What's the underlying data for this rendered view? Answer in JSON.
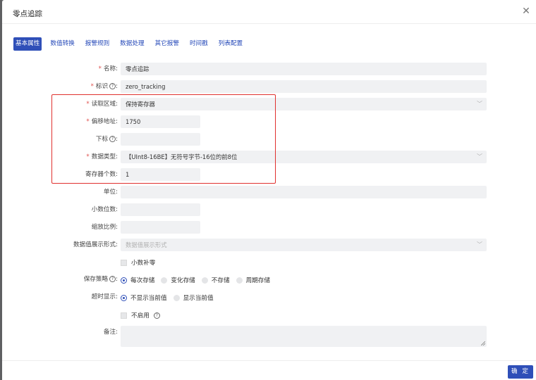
{
  "dialog": {
    "title": "零点追踪",
    "close_icon": "close-icon"
  },
  "tabs": [
    "基本属性",
    "数值转换",
    "报警规则",
    "数据处理",
    "其它报警",
    "时间戳",
    "列表配置"
  ],
  "form": {
    "name": {
      "label": "名称:",
      "value": "零点追踪",
      "required": true
    },
    "identifier": {
      "label": "标识",
      "value": "zero_tracking",
      "required": true
    },
    "read_area": {
      "label": "读取区域:",
      "value": "保持寄存器",
      "required": true
    },
    "offset": {
      "label": "偏移地址:",
      "value": "1750",
      "required": true
    },
    "subscript": {
      "label": "下标",
      "value": ""
    },
    "data_type": {
      "label": "数据类型:",
      "value": "【UInt8-16BE】无符号字节-16位的前8位",
      "required": true
    },
    "register_count": {
      "label": "寄存器个数:",
      "value": "1"
    },
    "unit": {
      "label": "单位:",
      "value": ""
    },
    "decimals": {
      "label": "小数位数:",
      "value": ""
    },
    "scale": {
      "label": "缩放比例:",
      "value": ""
    },
    "display_format": {
      "label": "数据值展示形式:",
      "placeholder": "数据值展示形式"
    },
    "decimal_pad": {
      "label": "小数补零"
    },
    "save_strategy": {
      "label": "保存策略",
      "options": [
        "每次存储",
        "变化存储",
        "不存储",
        "周期存储"
      ],
      "selected": 0
    },
    "timeout_display": {
      "label": "超时显示:",
      "options": [
        "不显示当前值",
        "显示当前值"
      ],
      "selected": 0
    },
    "disable": {
      "label": "不启用"
    },
    "remark": {
      "label": "备注:",
      "value": ""
    }
  },
  "footer": {
    "confirm": "确 定"
  },
  "colors": {
    "accent": "#2f4fb8",
    "required": "#e0524f",
    "highlight": "#e0302e"
  }
}
